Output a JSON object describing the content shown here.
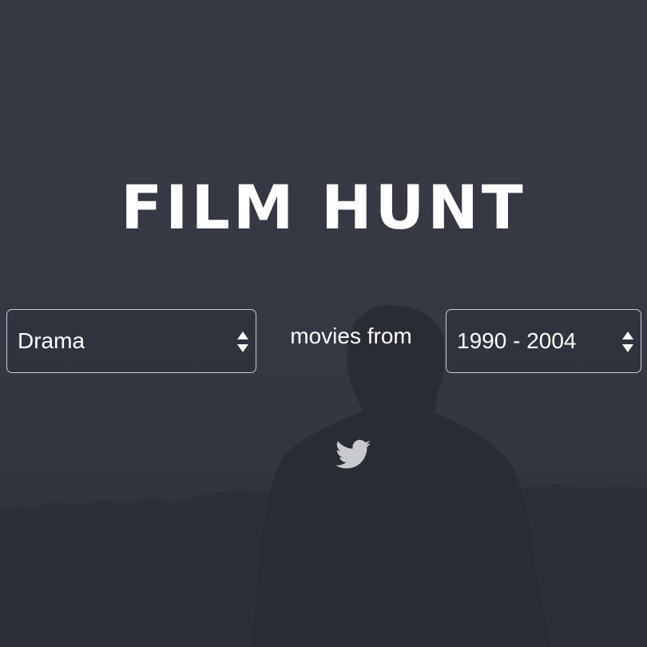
{
  "app": {
    "logo": "FILM HUNT"
  },
  "search": {
    "genre_value": "Drama",
    "connector_text": "movies from",
    "year_range_value": "1990 - 2004"
  },
  "social": {
    "twitter_icon": "twitter-bird-icon"
  },
  "colors": {
    "background": "#3a3d48",
    "text": "#ffffff",
    "icon": "#c9cacf"
  }
}
